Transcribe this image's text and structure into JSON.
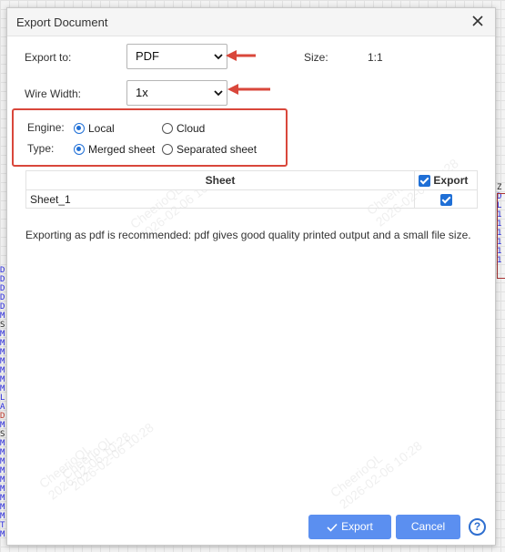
{
  "dialog": {
    "title": "Export Document"
  },
  "form": {
    "export_to": {
      "label": "Export to:",
      "value": "PDF"
    },
    "size": {
      "label": "Size:",
      "value": "1:1"
    },
    "wire_width": {
      "label": "Wire Width:",
      "value": "1x"
    },
    "engine": {
      "label": "Engine:",
      "options": [
        "Local",
        "Cloud"
      ],
      "selected": "Local"
    },
    "type": {
      "label": "Type:",
      "options": [
        "Merged sheet",
        "Separated sheet"
      ],
      "selected": "Merged sheet"
    }
  },
  "table": {
    "columns": [
      "Sheet",
      "Export"
    ],
    "rows": [
      {
        "sheet": "Sheet_1",
        "export": true
      }
    ]
  },
  "info_text": "Exporting as pdf is recommended: pdf gives good quality printed output and a small file size.",
  "watermark": {
    "line1": "CheerioQL",
    "line2": "2026-02-06 10:28"
  },
  "buttons": {
    "export": "Export",
    "cancel": "Cancel",
    "help": "?"
  },
  "colors": {
    "primary": "#5b8ff0",
    "highlight": "#d9473b",
    "check": "#1f6fd6"
  },
  "background": {
    "left_fragment": [
      "D",
      "D",
      "D",
      "D",
      "D",
      "M",
      "S",
      "M",
      "M",
      "M",
      "M",
      "M",
      "M",
      "M",
      "L",
      "A",
      "D",
      "M",
      "S",
      "M",
      "M",
      "M",
      "M",
      "M",
      "M",
      "M",
      "M",
      "M",
      "T",
      "M"
    ],
    "right_fragment": [
      "Z",
      "D",
      "L",
      "1",
      "1",
      "1",
      "1",
      "1",
      "1"
    ]
  }
}
